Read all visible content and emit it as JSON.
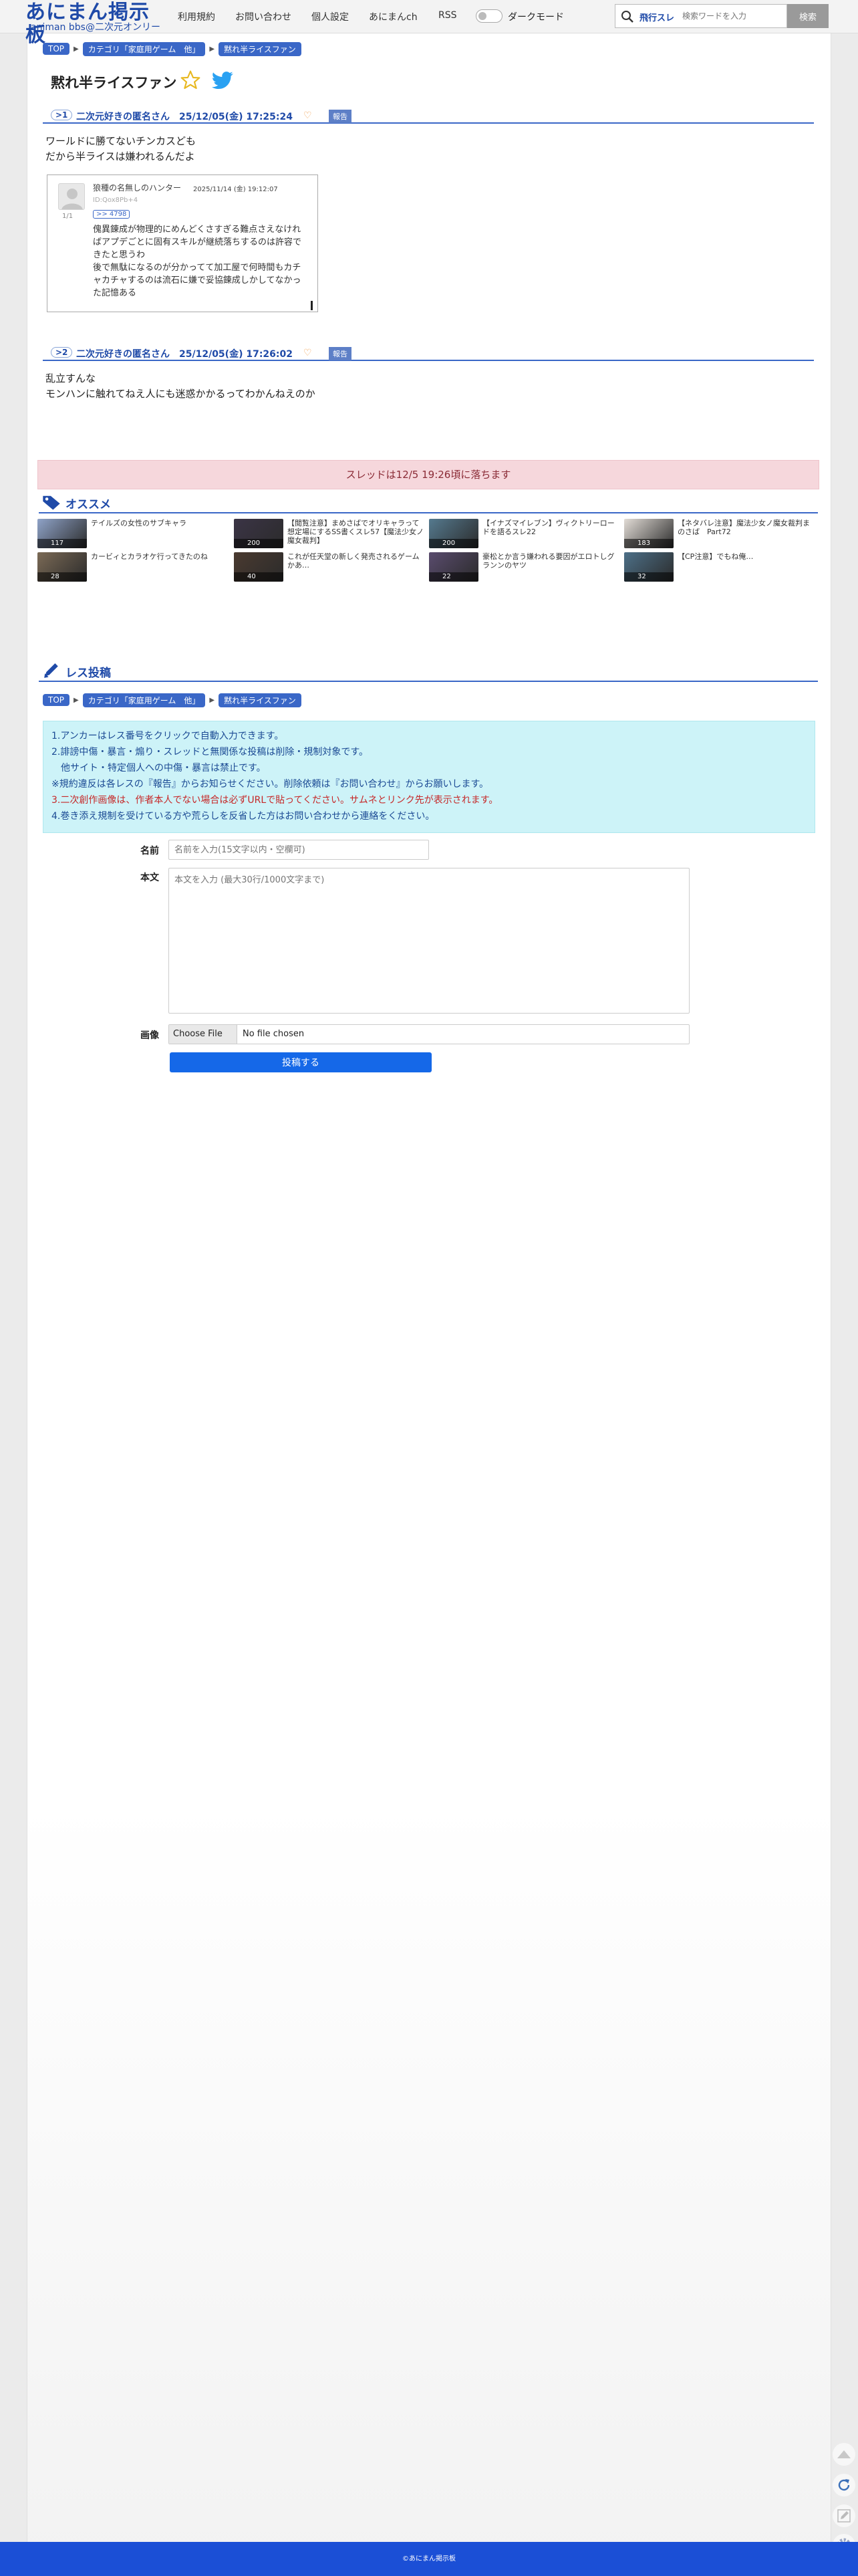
{
  "header": {
    "logo_main": "あにまん掲示板",
    "logo_sub": "animan bbs@二次元オンリー",
    "nav": [
      "利用規約",
      "お問い合わせ",
      "個人設定",
      "あにまんch",
      "RSS"
    ],
    "dark_mode_label": "ダークモード",
    "search_hot_label": "飛行スレ",
    "search_placeholder": "検索ワードを入力",
    "search_button": "検索"
  },
  "breadcrumb": {
    "top": "TOP",
    "category": "カテゴリ「家庭用ゲーム　他」",
    "thread": "黙れ半ライスファン"
  },
  "thread_title": "黙れ半ライスファン",
  "posts": [
    {
      "num": ">1",
      "meta": "二次元好きの匿名さん　25/12/05(金) 17:25:24",
      "report": "報告",
      "body": "ワールドに勝てないチンカスども\nだから半ライスは嫌われるんだよ",
      "embed": {
        "avatar_num": "1/1",
        "name": "狼種の名無しのハンター",
        "date": "2025/11/14 (金) 19:12:07",
        "id": "ID:Qox8Pb+4",
        "anchor": ">> 4798",
        "text": "傀異錬成が物理的にめんどくさすぎる難点さえなければアプデごとに固有スキルが継続落ちするのは許容できたと思うわ\n後で無駄になるのが分かってて加工屋で何時間もカチャカチャするのは流石に嫌で妥協錬成しかしてなかった記憶ある"
      }
    },
    {
      "num": ">2",
      "meta": "二次元好きの匿名さん　25/12/05(金) 17:26:02",
      "report": "報告",
      "body": "乱立すんな\nモンハンに触れてねえ人にも迷惑かかるってわかんねえのか"
    }
  ],
  "notice": "スレッドは12/5 19:26頃に落ちます",
  "recommend": {
    "title": "オススメ",
    "items": [
      {
        "text": "テイルズの女性のサブキャラ",
        "count": "117",
        "color": "#8fa3c8"
      },
      {
        "text": "【閲覧注意】まめさばでオリキャラって想定場にするSS書くスレ57【魔法少女ノ魔女裁判】",
        "count": "200",
        "color": "#3b3446"
      },
      {
        "text": "【イナズマイレブン】ヴィクトリーロードを語るスレ22",
        "count": "200",
        "color": "#557a8f"
      },
      {
        "text": "【ネタバレ注意】魔法少女ノ魔女裁判まのさば　Part72",
        "count": "183",
        "color": "#e2dcd6"
      },
      {
        "text": "カービィとカラオケ行ってきたのね",
        "count": "28",
        "color": "#7b6a56"
      },
      {
        "text": "これが任天堂の新しく発売されるゲームかあ…",
        "count": "40",
        "color": "#4a3a30"
      },
      {
        "text": "豪松とか言う嫌われる要因がエロトしグランンのヤツ",
        "count": "22",
        "color": "#5a4c6e"
      },
      {
        "text": "【CP注意】でもね俺…",
        "count": "32",
        "color": "#4d7088"
      }
    ]
  },
  "form": {
    "title": "レス投稿",
    "rules": [
      "1.アンカーはレス番号をクリックで自動入力できます。",
      "2.誹謗中傷・暴言・煽り・スレッドと無関係な投稿は削除・規制対象です。",
      "　他サイト・特定個人への中傷・暴言は禁止です。",
      "※規約違反は各レスの『報告』からお知らせください。削除依頼は『お問い合わせ』からお願いします。",
      "3.二次創作画像は、作者本人でない場合は必ずURLで貼ってください。サムネとリンク先が表示されます。",
      "4.巻き添え規制を受けている方や荒らしを反省した方はお問い合わせから連絡をください。"
    ],
    "name_label": "名前",
    "name_placeholder": "名前を入力(15文字以内・空欄可)",
    "body_label": "本文",
    "body_placeholder": "本文を入力 (最大30行/1000文字まで)",
    "image_label": "画像",
    "file_button": "Choose File",
    "file_status": "No file chosen",
    "submit": "投稿する"
  },
  "footer": "©あにまん掲示板"
}
